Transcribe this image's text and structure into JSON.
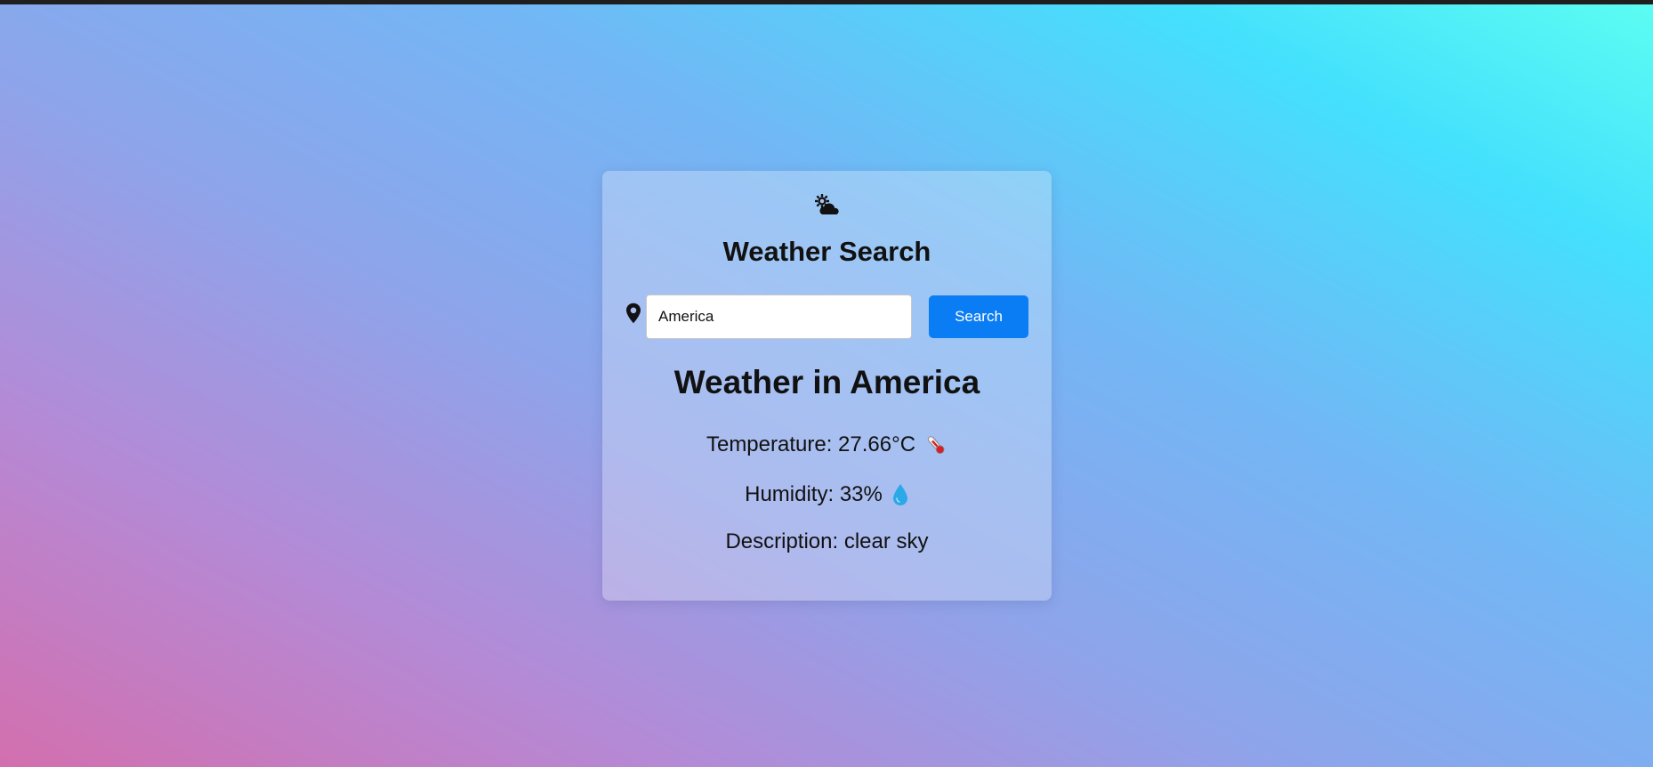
{
  "app": {
    "title": "Weather Search"
  },
  "search": {
    "value": "America",
    "button_label": "Search"
  },
  "result": {
    "heading": "Weather in America",
    "temperature_text": "Temperature: 27.66°C",
    "humidity_text": "Humidity: 33%",
    "description_text": "Description: clear sky"
  },
  "icons": {
    "logo": "sun-cloud-icon",
    "location": "map-pin-icon",
    "temperature": "thermometer-icon",
    "humidity": "water-drop-icon"
  },
  "colors": {
    "accent": "#0a7cf4",
    "gradient_start": "#d36fae",
    "gradient_end": "#5cfdf2"
  }
}
